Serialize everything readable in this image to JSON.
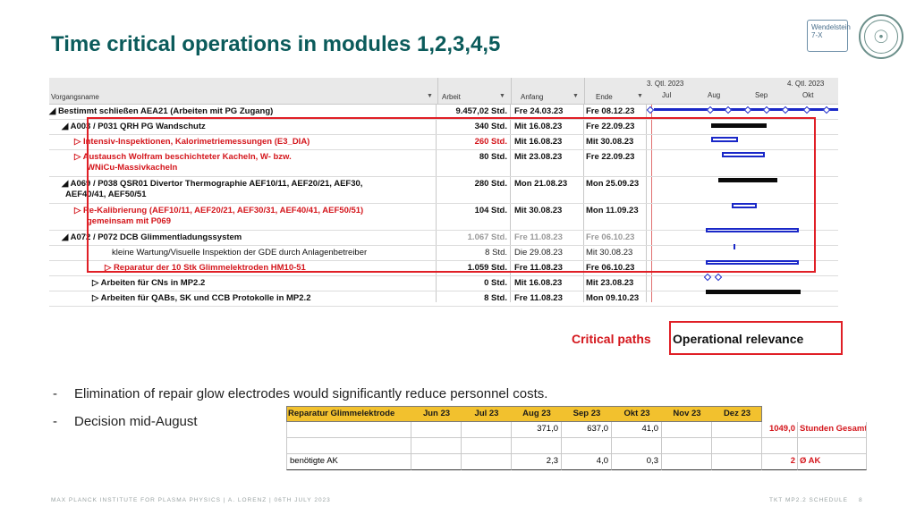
{
  "slide": {
    "title": "Time critical operations in modules 1,2,3,4,5",
    "logo_text": "Wendelstein 7-X"
  },
  "gantt": {
    "columns": {
      "name": "Vorgangsname",
      "work": "Arbeit",
      "start": "Anfang",
      "end": "Ende"
    },
    "quarters": [
      "3. Qtl. 2023",
      "4. Qtl. 2023"
    ],
    "months": [
      "Jul",
      "Aug",
      "Sep",
      "Okt"
    ],
    "rows": [
      {
        "name": "◢ Bestimmt schließen AEA21 (Arbeiten mit PG Zugang)",
        "work": "9.457,02 Std.",
        "start": "Fre 24.03.23",
        "end": "Fre 08.12.23",
        "style": "bold"
      },
      {
        "name": "◢ A003 / P031 QRH PG Wandschutz",
        "work": "340 Std.",
        "start": "Mit 16.08.23",
        "end": "Fre 22.09.23",
        "style": "bold"
      },
      {
        "name": "▷ Intensiv-Inspektionen, Kalorimetriemessungen (E3_DIA)",
        "work": "260 Std.",
        "start": "Mit 16.08.23",
        "end": "Mit 30.08.23",
        "style": "red"
      },
      {
        "name": "▷ Austausch Wolfram beschichteter Kacheln, W- bzw.",
        "name2": "WNiCu-Massivkacheln",
        "work": "80 Std.",
        "start": "Mit 23.08.23",
        "end": "Fre 22.09.23",
        "style": "red"
      },
      {
        "name": "◢ A069 / P038 QSR01 Divertor Thermographie AEF10/11, AEF20/21, AEF30,",
        "name2": "AEF40/41, AEF50/51",
        "work": "280 Std.",
        "start": "Mon 21.08.23",
        "end": "Mon 25.09.23",
        "style": "bold"
      },
      {
        "name": "▷ Re-Kalibrierung (AEF10/11, AEF20/21, AEF30/31, AEF40/41, AEF50/51)",
        "name2": "gemeinsam mit P069",
        "work": "104 Std.",
        "start": "Mit 30.08.23",
        "end": "Mon 11.09.23",
        "style": "red"
      },
      {
        "name": "◢ A072 / P072 DCB Glimmentladungssystem",
        "work": "1.067 Std.",
        "start": "Fre 11.08.23",
        "end": "Fre 06.10.23",
        "style": "grey"
      },
      {
        "name": "kleine Wartung/Visuelle Inspektion der GDE durch Anlagenbetreiber",
        "work": "8 Std.",
        "start": "Die 29.08.23",
        "end": "Mit 30.08.23",
        "style": "normal"
      },
      {
        "name": "▷ Reparatur der 10 Stk Glimmelektroden HM10-51",
        "work": "1.059 Std.",
        "start": "Fre 11.08.23",
        "end": "Fre 06.10.23",
        "style": "red"
      },
      {
        "name": "▷ Arbeiten für CNs in MP2.2",
        "work": "0 Std.",
        "start": "Mit 16.08.23",
        "end": "Mit 23.08.23",
        "style": "bold"
      },
      {
        "name": "▷ Arbeiten für QABs, SK und CCB Protokolle in MP2.2",
        "work": "8 Std.",
        "start": "Fre 11.08.23",
        "end": "Mon 09.10.23",
        "style": "bold"
      }
    ]
  },
  "legend": {
    "critical": "Critical paths",
    "operational": "Operational relevance"
  },
  "bullets": [
    {
      "dash": "-",
      "text": "Elimination of repair glow electrodes would significantly reduce personnel costs."
    },
    {
      "dash": "-",
      "text": "Decision mid-August"
    }
  ],
  "sheet": {
    "header": [
      "Reparatur Glimmelektrode",
      "Jun 23",
      "Jul 23",
      "Aug 23",
      "Sep 23",
      "Okt 23",
      "Nov 23",
      "Dez 23"
    ],
    "hours_row": [
      "",
      "",
      "",
      "371,0",
      "637,0",
      "41,0",
      "",
      ""
    ],
    "hours_total": "1049,0",
    "hours_total_label": "Stunden Gesamt",
    "ak_label": "benötigte AK",
    "ak_row": [
      "",
      "",
      "2,3",
      "4,0",
      "0,3",
      "",
      ""
    ],
    "ak_total": "2",
    "ak_total_label": "Ø AK"
  },
  "footer": {
    "left": "MAX PLANCK INSTITUTE FOR PLASMA PHYSICS | A. LORENZ | 06TH JULY 2023",
    "right": "TKT MP2.2 SCHEDULE",
    "page": "8"
  },
  "colors": {
    "title": "#0b5b5b",
    "critical_red": "#d4161c",
    "sheet_header": "#f2c12e"
  }
}
